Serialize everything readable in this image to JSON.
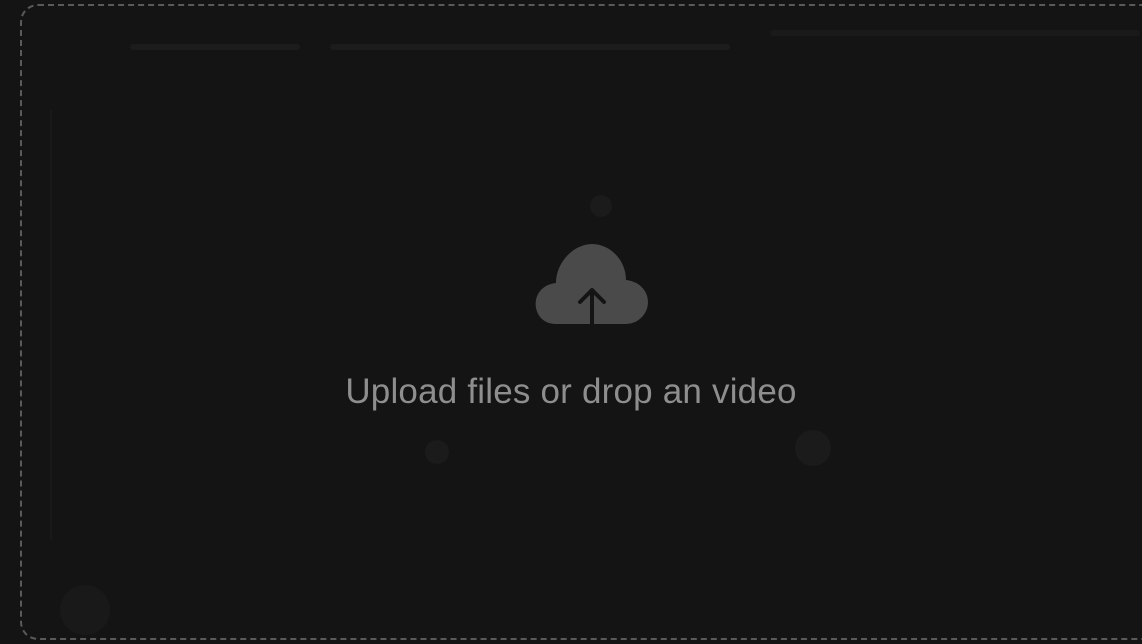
{
  "dropzone": {
    "icon": "cloud-upload-icon",
    "text": "Upload files or drop an video"
  },
  "colors": {
    "background": "#141414",
    "dashed_border": "#5a5a5a",
    "icon": "#4a4a4a",
    "text": "#8e8e8e"
  }
}
